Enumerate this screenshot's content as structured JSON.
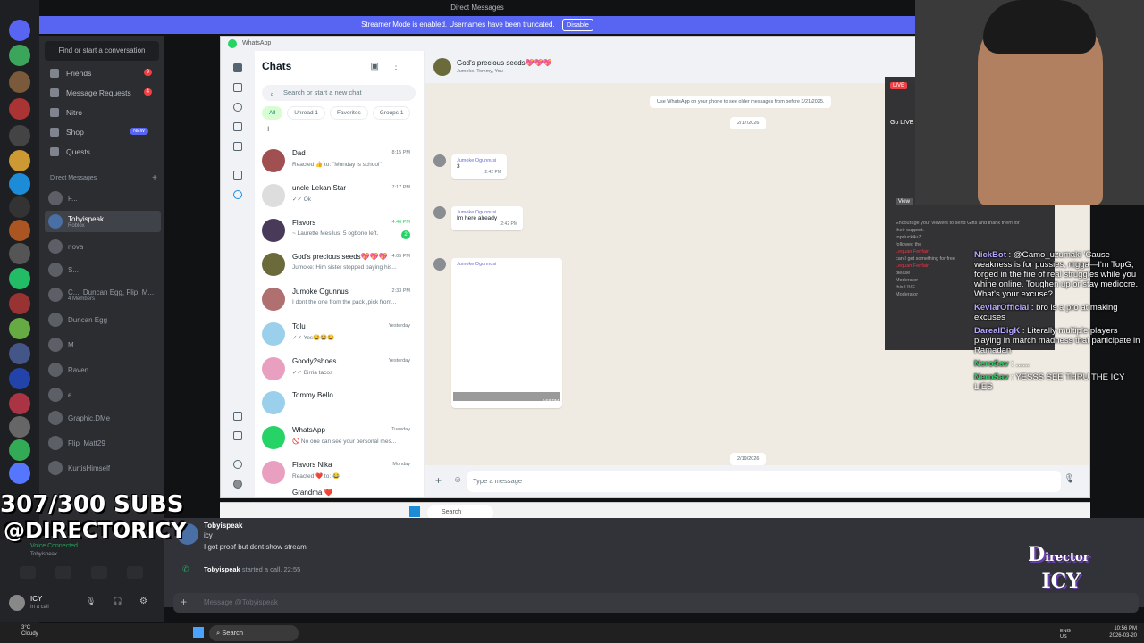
{
  "window": {
    "title": "Direct Messages"
  },
  "streamer_banner": {
    "text": "Streamer Mode is enabled. Usernames have been truncated.",
    "disable_label": "Disable"
  },
  "discord": {
    "find_placeholder": "Find or start a conversation",
    "nav": [
      {
        "label": "Friends",
        "badge": "9"
      },
      {
        "label": "Message Requests",
        "badge": "4"
      },
      {
        "label": "Nitro",
        "badge": ""
      },
      {
        "label": "Shop",
        "badge": "NEW"
      },
      {
        "label": "Quests",
        "badge": ""
      }
    ],
    "dm_header": "Direct Messages",
    "dm_add": "+",
    "dms": [
      {
        "name": "F...",
        "sub": ""
      },
      {
        "name": "Tobyispeak",
        "sub": "Roblox"
      },
      {
        "name": "nova",
        "sub": ""
      },
      {
        "name": "S...",
        "sub": ""
      },
      {
        "name": "C..., Duncan Egg, Flip_M...",
        "sub": "4 Members"
      },
      {
        "name": "Duncan Egg",
        "sub": ""
      },
      {
        "name": "M...",
        "sub": ""
      },
      {
        "name": "Raven",
        "sub": ""
      },
      {
        "name": "e...",
        "sub": ""
      },
      {
        "name": "Graphic.DMe",
        "sub": ""
      },
      {
        "name": "Flip_Matt29",
        "sub": ""
      },
      {
        "name": "KurtisHimself",
        "sub": ""
      }
    ],
    "user": {
      "name": "ICY",
      "status": "In a call"
    },
    "voice": {
      "status": "Voice Connected",
      "channel": "Tobyispeak"
    },
    "chat": {
      "author": "Tobyispeak",
      "lines": [
        "icy",
        "I got proof but dont show stream"
      ],
      "call_user": "Tobyispeak",
      "call_text": "started a call.",
      "call_time": "22:55",
      "input_placeholder": "Message @Tobyispeak"
    }
  },
  "whatsapp": {
    "app_title": "WhatsApp",
    "heading": "Chats",
    "search_placeholder": "Search or start a new chat",
    "chips": [
      "All",
      "Unread 1",
      "Favorites",
      "Groups 1"
    ],
    "chats": [
      {
        "name": "Dad",
        "preview": "Reacted 👍 to: \"Monday is school\"",
        "time": "8:15 PM",
        "unread": ""
      },
      {
        "name": "uncle Lekan Star",
        "preview": "✓✓ Ok",
        "time": "7:17 PM",
        "unread": ""
      },
      {
        "name": "Flavors",
        "preview": "~ Laurette Mesilus: 5 ogbono left.",
        "time": "4:46 PM",
        "unread": "2"
      },
      {
        "name": "God's precious seeds💖💖💖",
        "preview": "Jumoke: Him sister stopped paying his...",
        "time": "4:05 PM",
        "unread": ""
      },
      {
        "name": "Jumoke Ogunnusi",
        "preview": "I dont the one from the pack ,pick from...",
        "time": "2:33 PM",
        "unread": ""
      },
      {
        "name": "Tolu",
        "preview": "✓✓ Yes😂😂😂",
        "time": "Yesterday",
        "unread": ""
      },
      {
        "name": "Goody2shoes",
        "preview": "✓✓ Birria tacos",
        "time": "Yesterday",
        "unread": ""
      },
      {
        "name": "Tommy Bello",
        "preview": "",
        "time": "",
        "unread": ""
      },
      {
        "name": "WhatsApp",
        "preview": "🚫 No one can see your personal mes...",
        "time": "Tuesday",
        "unread": ""
      },
      {
        "name": "Flavors Nika",
        "preview": "Reacted ❤️ to: 😂",
        "time": "Monday",
        "unread": ""
      },
      {
        "name": "Grandma ❤️",
        "preview": "",
        "time": "",
        "unread": ""
      }
    ],
    "chat": {
      "name": "God's precious seeds💖💖💖",
      "members": "Jumoke, Tommy, You",
      "sys_msg": "Use WhatsApp on your phone to see older messages from before 3/21/2025.",
      "date1": "2/17/2026",
      "messages": [
        {
          "author": "Jumoke Ogunnusi",
          "text": "3",
          "time": "2:42 PM"
        },
        {
          "author": "Jumoke Ogunnusi",
          "text": "Im here already",
          "time": "2:42 PM"
        },
        {
          "author": "Jumoke Ogunnusi",
          "text": "",
          "time": "4:58 PM"
        }
      ],
      "date2": "2/19/2026",
      "input_placeholder": "Type a message"
    }
  },
  "live_panel": {
    "badge": "LIVE",
    "go_live": "Go LIVE",
    "lines": [
      "Encourage your viewers to send Gifts and thank them for their support.",
      "topduck4u7",
      "followed the",
      "Lequan Fenfair",
      "can I get something for free",
      "Lequan Fenfair",
      "please",
      "Moderator",
      "this LIVE",
      "Moderator"
    ],
    "view": "View"
  },
  "stream_chat": [
    {
      "user": "NickBot",
      "text": "@Gamo_uzumaki 'Cause weakness is for pussies, nigga—I'm TopG, forged in the fire of real struggles while you whine online. Toughen up or stay mediocre. What's your excuse?"
    },
    {
      "user": "KevlarOfficial",
      "text": "bro is a pro at making excuses"
    },
    {
      "user": "DarealBigK",
      "text": "Literally multiple players playing in march madness that participate in Ramadan"
    },
    {
      "user": "NeroSav",
      "text": "......"
    },
    {
      "user": "NeroSav",
      "text": "YESSS SEE THRU THE ICY LIES"
    }
  ],
  "overlay": {
    "subs": "307/300 SUBS",
    "handle": "@DIRECTORICY",
    "logo": "Director Icy"
  },
  "taskbar": {
    "search": "Search",
    "lang": "ENG US",
    "time": "10:56 PM",
    "date": "2026-03-20",
    "weather_temp": "3°C",
    "weather_text": "Cloudy"
  },
  "wa_taskbar": {
    "search": "Search"
  },
  "colors": {
    "discord_blurple": "#5865f2",
    "whatsapp_green": "#25d366",
    "discord_bg": "#313338"
  }
}
